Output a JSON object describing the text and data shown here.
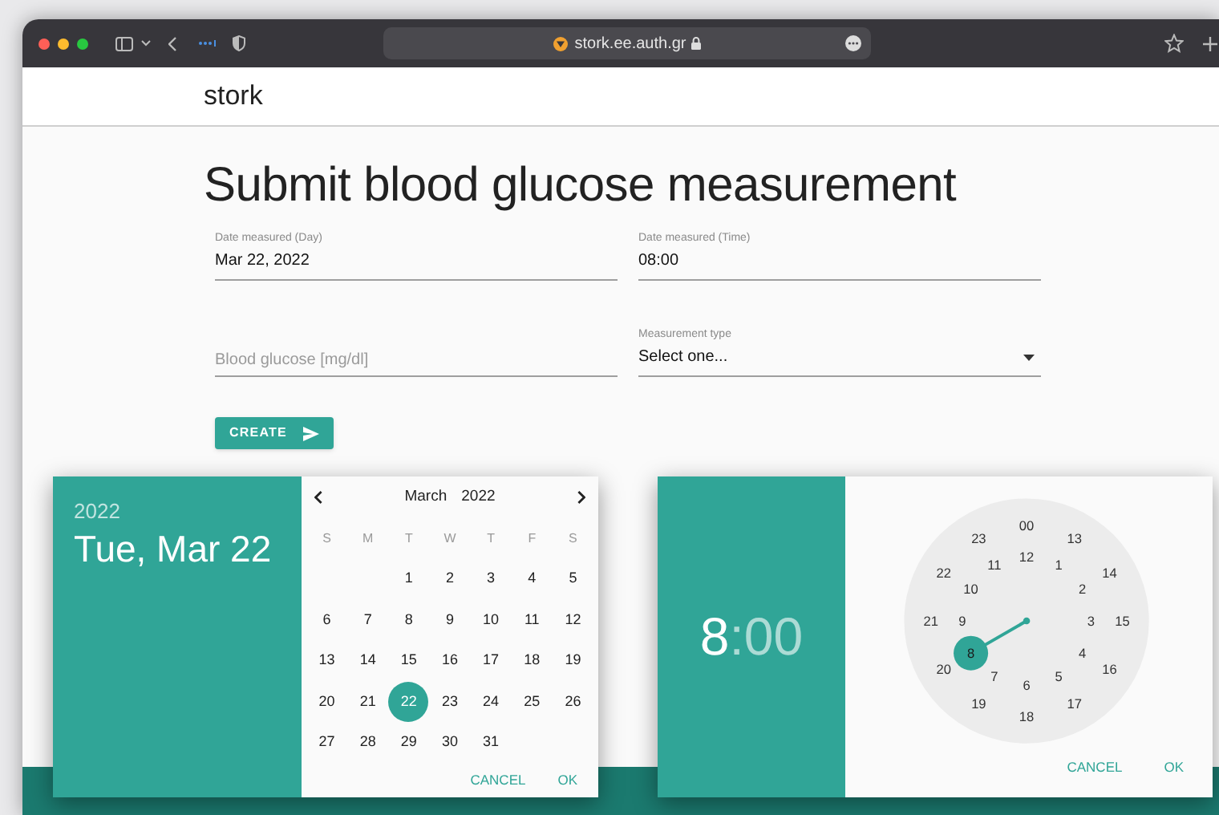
{
  "browser": {
    "url": "stork.ee.auth.gr"
  },
  "app": {
    "brand": "stork"
  },
  "page": {
    "title": "Submit blood glucose measurement"
  },
  "form": {
    "rows": [
      {
        "fields": [
          {
            "kind": "text",
            "label": "Date measured (Day)",
            "value": "Mar 22, 2022"
          },
          {
            "kind": "text",
            "label": "Date measured (Time)",
            "value": "08:00"
          }
        ]
      },
      {
        "fields": [
          {
            "kind": "input",
            "placeholder": "Blood glucose [mg/dl]"
          },
          {
            "kind": "select",
            "label": "Measurement type",
            "value": "Select one..."
          }
        ]
      }
    ],
    "submit": "CREATE"
  },
  "date_picker": {
    "year": "2022",
    "date": "Tue, Mar 22",
    "month": "March",
    "month_year": "2022",
    "weekdays": [
      "S",
      "M",
      "T",
      "W",
      "T",
      "F",
      "S"
    ],
    "weeks": [
      {
        "days": [
          {
            "label": "1",
            "selected": false
          },
          {
            "label": "2",
            "selected": false
          },
          {
            "label": "3",
            "selected": false
          },
          {
            "label": "4",
            "selected": false
          },
          {
            "label": "5",
            "selected": false
          }
        ]
      },
      {
        "days": [
          {
            "label": "6",
            "selected": false
          },
          {
            "label": "7",
            "selected": false
          },
          {
            "label": "8",
            "selected": false
          },
          {
            "label": "9",
            "selected": false
          },
          {
            "label": "10",
            "selected": false
          },
          {
            "label": "11",
            "selected": false
          },
          {
            "label": "12",
            "selected": false
          }
        ]
      },
      {
        "days": [
          {
            "label": "13",
            "selected": false
          },
          {
            "label": "14",
            "selected": false
          },
          {
            "label": "15",
            "selected": false
          },
          {
            "label": "16",
            "selected": false
          },
          {
            "label": "17",
            "selected": false
          },
          {
            "label": "18",
            "selected": false
          },
          {
            "label": "19",
            "selected": false
          }
        ]
      },
      {
        "days": [
          {
            "label": "20",
            "selected": false
          },
          {
            "label": "21",
            "selected": false
          },
          {
            "label": "22",
            "selected": true
          },
          {
            "label": "23",
            "selected": false
          },
          {
            "label": "24",
            "selected": false
          },
          {
            "label": "25",
            "selected": false
          },
          {
            "label": "26",
            "selected": false
          }
        ]
      },
      {
        "days": [
          {
            "label": "27",
            "selected": false
          },
          {
            "label": "28",
            "selected": false
          },
          {
            "label": "29",
            "selected": false
          },
          {
            "label": "30",
            "selected": false
          },
          {
            "label": "31",
            "selected": false
          }
        ]
      }
    ],
    "buttons": [
      "CANCEL",
      "OK"
    ]
  },
  "time_picker": {
    "hour": {
      "text": "8",
      "selected": true
    },
    "minute": {
      "text": ":00",
      "selected": false
    },
    "outer_hours": [
      {
        "label": "00",
        "selected": false
      },
      {
        "label": "13",
        "selected": false
      },
      {
        "label": "14",
        "selected": false
      },
      {
        "label": "15",
        "selected": false
      },
      {
        "label": "16",
        "selected": false
      },
      {
        "label": "17",
        "selected": false
      },
      {
        "label": "18",
        "selected": false
      },
      {
        "label": "19",
        "selected": false
      },
      {
        "label": "20",
        "selected": false
      },
      {
        "label": "21",
        "selected": false
      },
      {
        "label": "22",
        "selected": false
      },
      {
        "label": "23",
        "selected": false
      }
    ],
    "inner_hours": [
      {
        "label": "12",
        "selected": false
      },
      {
        "label": "1",
        "selected": false
      },
      {
        "label": "2",
        "selected": false
      },
      {
        "label": "3",
        "selected": false
      },
      {
        "label": "4",
        "selected": false
      },
      {
        "label": "5",
        "selected": false
      },
      {
        "label": "6",
        "selected": false
      },
      {
        "label": "7",
        "selected": false
      },
      {
        "label": "8",
        "selected": true
      },
      {
        "label": "9",
        "selected": false
      },
      {
        "label": "10",
        "selected": false
      },
      {
        "label": "11",
        "selected": false
      }
    ],
    "buttons": [
      "CANCEL",
      "OK"
    ]
  }
}
